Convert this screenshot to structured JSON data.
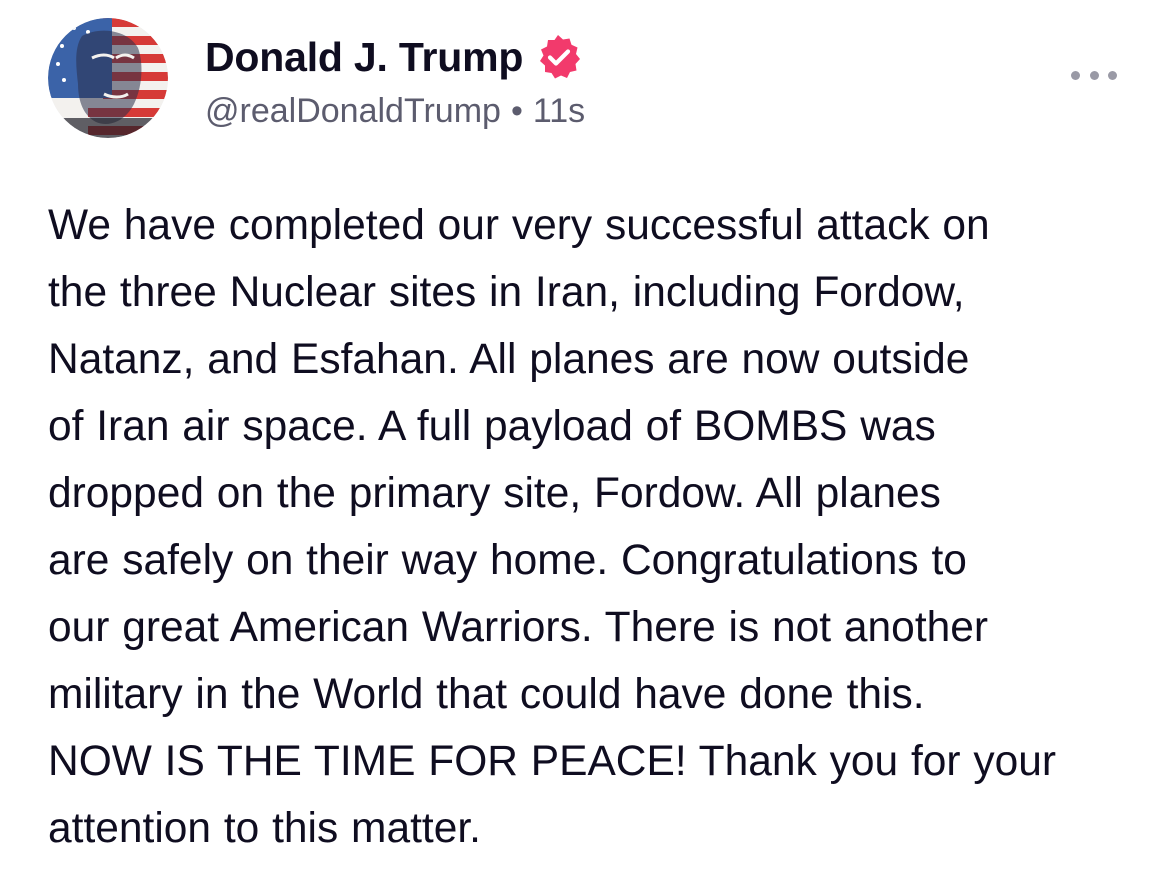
{
  "author": {
    "display_name": "Donald J. Trump",
    "handle": "@realDonaldTrump",
    "separator": "•",
    "time": "11s",
    "verified_icon": "verified-badge-icon",
    "verified_color": "#f23a6c",
    "avatar_icon": "flag-portrait-avatar"
  },
  "actions": {
    "more_icon": "more-options-icon"
  },
  "post": {
    "lines": [
      "We have completed our very successful attack on",
      "the three Nuclear sites in Iran, including Fordow,",
      "Natanz, and Esfahan. All planes are now outside",
      "of Iran air space. A full payload of BOMBS was",
      "dropped on the primary site, Fordow. All planes",
      "are safely on their way home. Congratulations to",
      "our great American Warriors. There is not another",
      "military in the World that could have done this.",
      "NOW IS THE TIME FOR PEACE! Thank you for your",
      "attention to this matter."
    ]
  }
}
